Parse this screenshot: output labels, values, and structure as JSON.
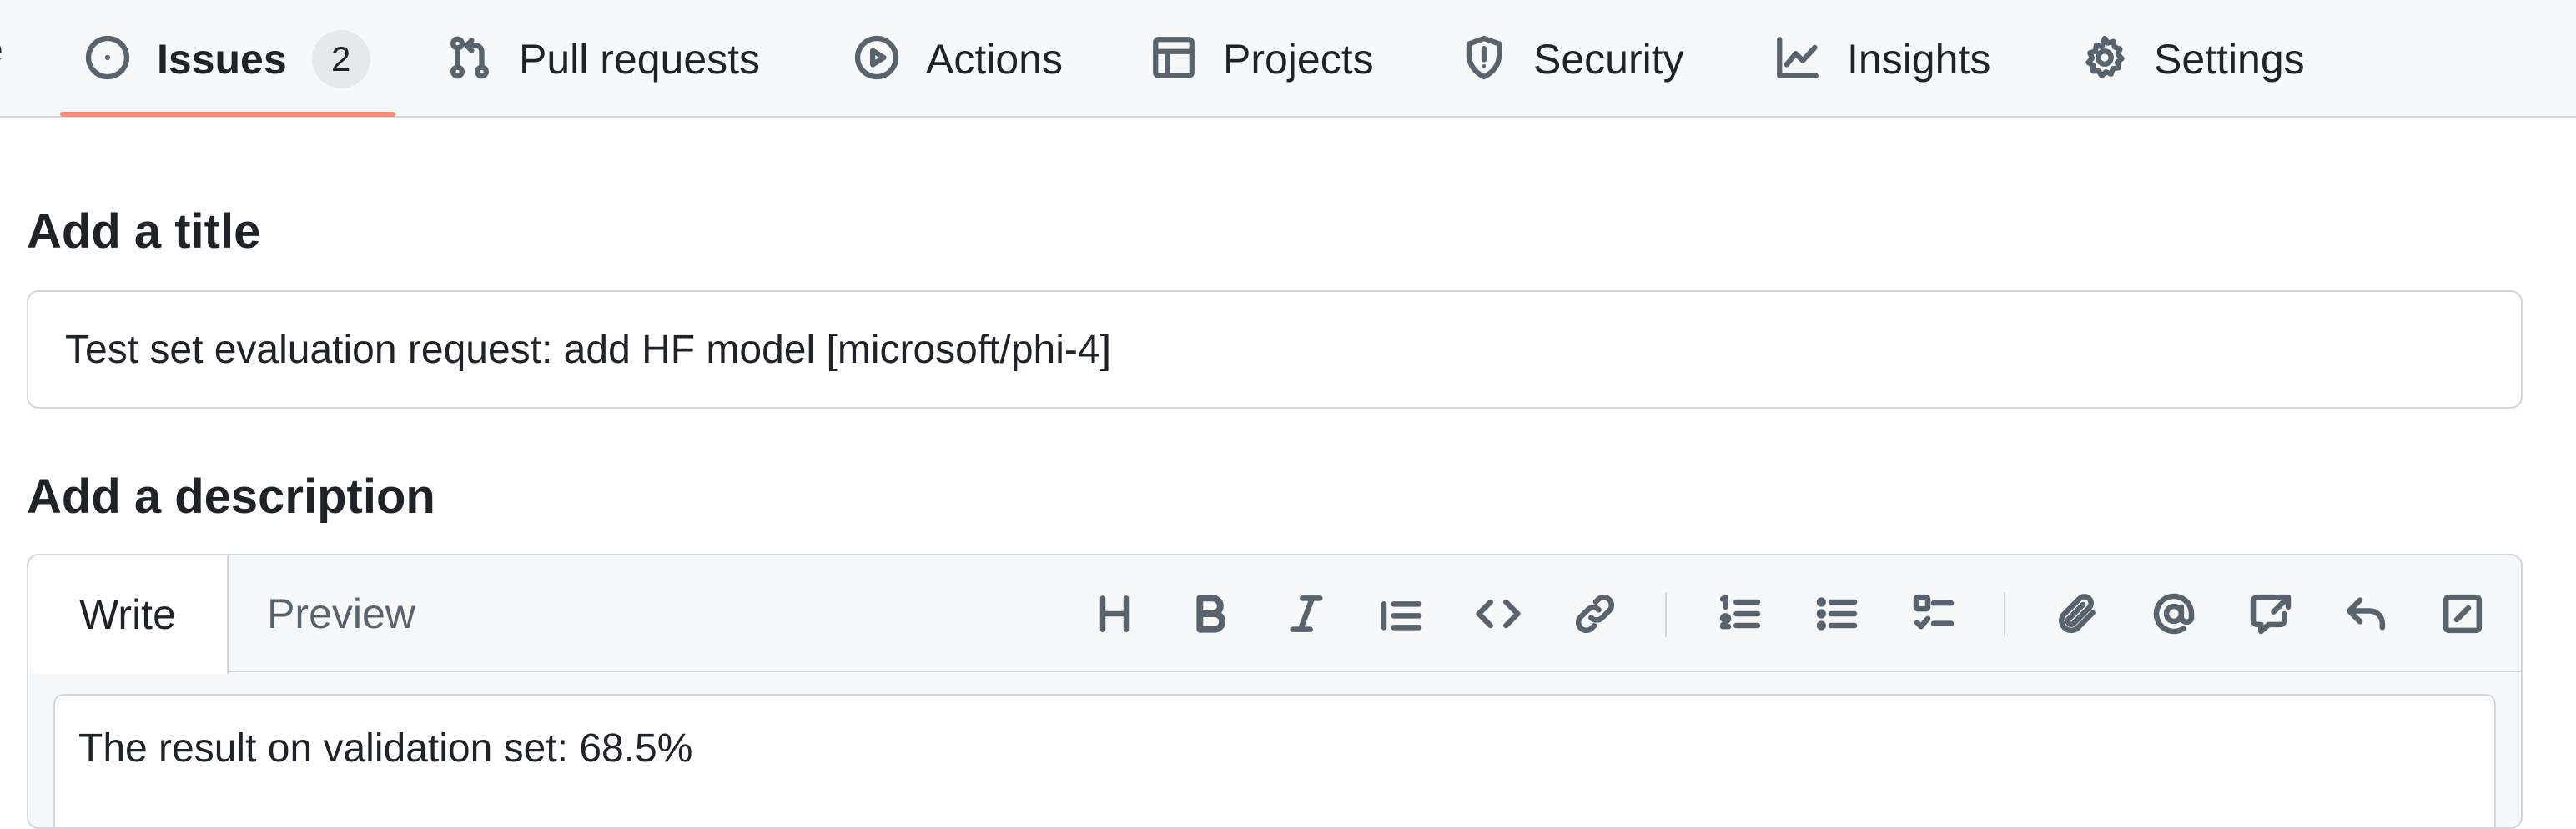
{
  "nav": {
    "clipped_text": "e",
    "items": [
      {
        "label": "Issues",
        "icon": "issue-opened-icon",
        "count": "2",
        "selected": true
      },
      {
        "label": "Pull requests",
        "icon": "git-pull-request-icon"
      },
      {
        "label": "Actions",
        "icon": "play-icon"
      },
      {
        "label": "Projects",
        "icon": "table-icon"
      },
      {
        "label": "Security",
        "icon": "shield-icon"
      },
      {
        "label": "Insights",
        "icon": "graph-icon"
      },
      {
        "label": "Settings",
        "icon": "gear-icon"
      }
    ],
    "selected_underline_color": "#fd8c73"
  },
  "form": {
    "title_heading": "Add a title",
    "title_value": "Test set evaluation request: add HF model [microsoft/phi-4]",
    "description_heading": "Add a description",
    "tabs": [
      "Write",
      "Preview"
    ],
    "active_tab": "Write",
    "toolbar": [
      "heading-icon",
      "bold-icon",
      "italic-icon",
      "quote-icon",
      "code-icon",
      "link-icon",
      "ordered-list-icon",
      "unordered-list-icon",
      "task-list-icon",
      "paperclip-icon",
      "mention-icon",
      "cross-reference-icon",
      "reply-icon",
      "slash-command-icon"
    ],
    "body_value": "The result on validation set: 68.5%"
  },
  "colors": {
    "accent_underline": "#fd8c73",
    "border": "#d0d7de",
    "muted": "#59636e"
  }
}
